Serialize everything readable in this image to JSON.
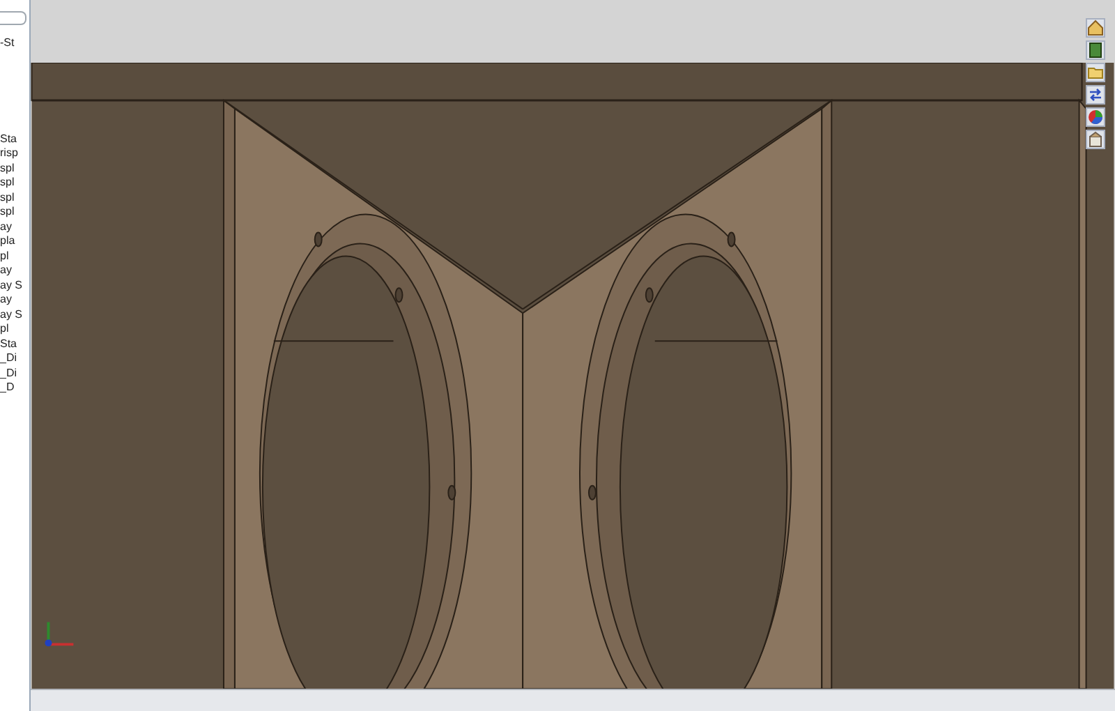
{
  "feature_tree": {
    "header": "-St",
    "items": [
      "Sta",
      "risp",
      "spl",
      "spl",
      "spl",
      "spl",
      "ay",
      "pla",
      "pl",
      "ay",
      "ay S",
      "ay",
      "ay S",
      "pl",
      "Sta",
      "_Di",
      "_Di",
      "_D"
    ]
  }
}
